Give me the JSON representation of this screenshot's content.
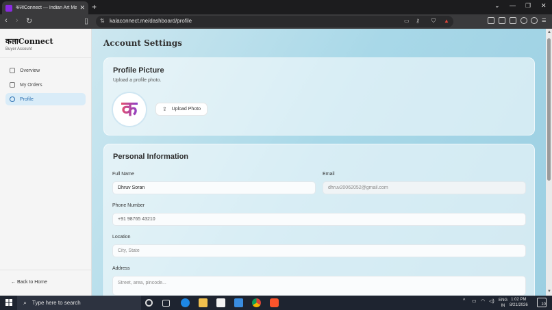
{
  "browser": {
    "tab_title": "कलाConnect — Indian Art Mark…",
    "url": "kalaconnect.me/dashboard/profile"
  },
  "sidebar": {
    "brand": "कलाConnect",
    "subtitle": "Buyer Account",
    "items": [
      {
        "label": "Overview",
        "icon": "grid-icon",
        "active": false
      },
      {
        "label": "My Orders",
        "icon": "card-icon",
        "active": false
      },
      {
        "label": "Profile",
        "icon": "user-icon",
        "active": true
      }
    ],
    "back_label": "← Back to Home"
  },
  "main": {
    "title": "Account Settings",
    "profile_picture": {
      "title": "Profile Picture",
      "subtitle": "Upload a profile photo.",
      "avatar_glyph": "क",
      "upload_label": "Upload Photo"
    },
    "personal_info": {
      "title": "Personal Information",
      "full_name_label": "Full Name",
      "full_name_value": "Dhruv Soran",
      "email_label": "Email",
      "email_value": "dhruv20062052@gmail.com",
      "phone_label": "Phone Number",
      "phone_value": "+91 98765 43210",
      "location_label": "Location",
      "location_placeholder": "City, State",
      "address_label": "Address",
      "address_placeholder": "Street, area, pincode..."
    }
  },
  "taskbar": {
    "search_placeholder": "Type here to search",
    "lang_top": "ENG",
    "lang_bottom": "IN",
    "time": "1:02 PM",
    "date": "8/21/2026",
    "notification_count": "10"
  },
  "colors": {
    "accent": "#2a6fb0",
    "active_nav_bg": "#d9ecf8",
    "page_gradient_start": "#d9ecf2",
    "page_gradient_end": "#9ccfe2"
  }
}
